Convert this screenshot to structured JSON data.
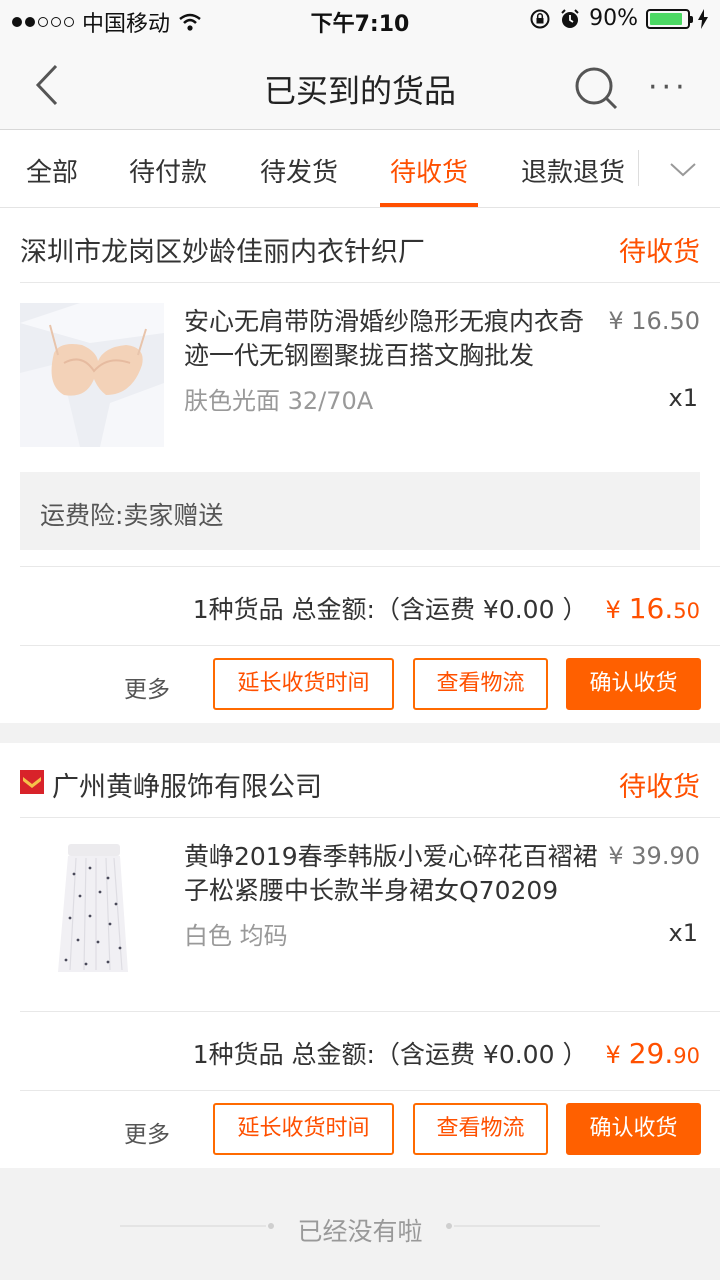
{
  "status_bar": {
    "carrier": "中国移动",
    "time": "下午7:10",
    "battery": "90%",
    "battery_level": 0.9,
    "icons": [
      "signal-dots-icon",
      "wifi-icon",
      "rotation-lock-icon",
      "alarm-icon",
      "battery-icon",
      "charging-icon"
    ]
  },
  "nav": {
    "title": "已买到的货品",
    "back_icon": "chevron-left-icon",
    "search_icon": "search-icon",
    "more_label": "···"
  },
  "tabs": [
    {
      "label": "全部",
      "active": false
    },
    {
      "label": "待付款",
      "active": false
    },
    {
      "label": "待发货",
      "active": false
    },
    {
      "label": "待收货",
      "active": true
    },
    {
      "label": "退款退货",
      "active": false
    }
  ],
  "accent_color": "#ff5000",
  "orders": [
    {
      "shop": "深圳市龙岗区妙龄佳丽内衣针织厂",
      "status": "待收货",
      "product_title": "安心无肩带防滑婚纱隐形无痕内衣奇迹一代无钢圈聚拢百搭文胸批发",
      "sku": "肤色光面 32/70A",
      "price": "¥ 16.50",
      "qty": "x1",
      "insurance": "运费险:卖家赠送",
      "summary": "1种货品 总金额:（含运费 ¥0.00 ）",
      "total_currency": "¥",
      "total_int": "16.",
      "total_dec": "50",
      "more": "更多",
      "buttons": {
        "extend": "延长收货时间",
        "logistics": "查看物流",
        "confirm": "确认收货"
      }
    },
    {
      "shop": "广州黄峥服饰有限公司",
      "status": "待收货",
      "product_title": "黄峥2019春季韩版小爱心碎花百褶裙子松紧腰中长款半身裙女Q70209",
      "sku": "白色 均码",
      "price": "¥ 39.90",
      "qty": "x1",
      "summary": "1种货品 总金额:（含运费 ¥0.00 ）",
      "total_currency": "¥",
      "total_int": "29.",
      "total_dec": "90",
      "more": "更多",
      "buttons": {
        "extend": "延长收货时间",
        "logistics": "查看物流",
        "confirm": "确认收货"
      }
    }
  ],
  "footer": {
    "end_text": "已经没有啦"
  }
}
